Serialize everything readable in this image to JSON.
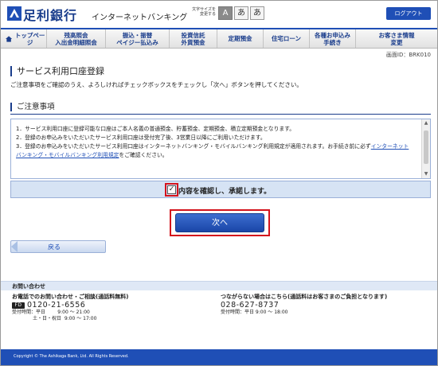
{
  "header": {
    "bank_name": "足利銀行",
    "service_name": "インターネットバンキング",
    "font_size_label": "文字サイズを変更する",
    "font_size_options": [
      "A",
      "あ",
      "あ"
    ],
    "logout_label": "ログアウト"
  },
  "nav": {
    "items": [
      "トップページ",
      "残高照会\n入出金明細照会",
      "振込・振替\nペイジー払込み",
      "投資信託\n外貨預金",
      "定期預金",
      "住宅ローン",
      "各種お申込み\n手続き",
      "お客さま情報\n変更"
    ]
  },
  "screen_id": "画面ID：BRK010",
  "page": {
    "title": "サービス利用口座登録",
    "lead": "ご注意事項をご確認のうえ、よろしければチェックボックスをチェックし「次へ」ボタンを押してください。"
  },
  "notes": {
    "title": "ご注意事項",
    "items": [
      "1．サービス利用口座に登録可能な口座はご本人名義の普通預金、貯蓄預金、定期預金、積立定期預金となります。",
      "2．登録のお申込みをいただいたサービス利用口座は受付完了後、3営業日以降にご利用いただけます。",
      "3．登録のお申込みをいただいたサービス利用口座はインターネットバンキング・モバイルバンキング利用規定が適用されます。お手続き前に必ず"
    ],
    "link_text": "インターネットバンキング・モバイルバンキング利用規定",
    "link_suffix": "をご確認ください。"
  },
  "consent": {
    "checked": true,
    "check_mark": "✓",
    "label": "内容を確認し、承諾します。"
  },
  "buttons": {
    "next": "次へ",
    "back": "戻る"
  },
  "contact": {
    "heading": "お問い合わせ",
    "left": {
      "title": "お電話でのお問い合わせ・ご相談(通話料無料)",
      "icon_text": "FD",
      "phone": "0120-21-6556",
      "hours_label": "受付時間：平日",
      "hours_weekday": "9:00 〜 21:00",
      "hours_weekend_label": "土・日・祝日",
      "hours_weekend": "9:00 〜 17:00"
    },
    "right": {
      "title": "つながらない場合はこちら(通話料はお客さまのご負担となります)",
      "phone": "028-627-8737",
      "hours": "受付時間：平日 9:00 〜 18:00"
    }
  },
  "footer": {
    "copyright": "Copyright © The Ashikaga Bank, Ltd. All Rights Reserved."
  },
  "colors": {
    "brand_blue": "#1f4fb6",
    "highlight_red": "#d4131c",
    "consent_bg": "#d6e3f4"
  }
}
